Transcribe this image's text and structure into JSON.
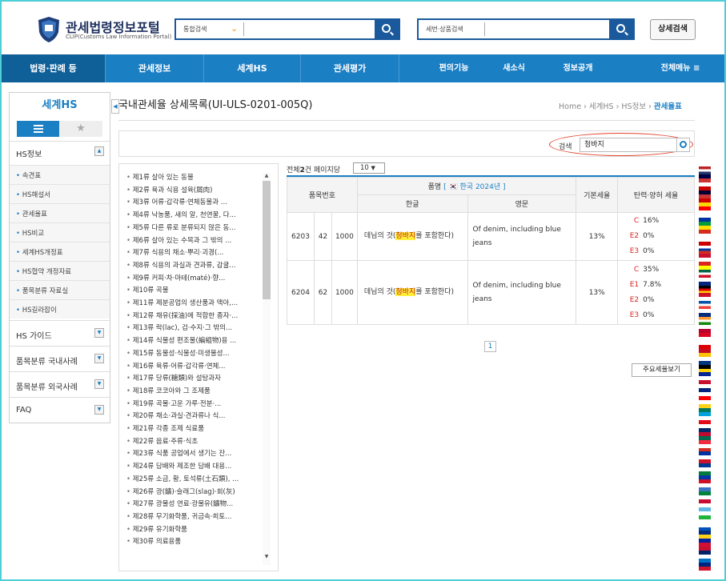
{
  "header": {
    "logo_title": "관세법령정보포털",
    "logo_sub": "CLIP(Customs Law Information Portal)",
    "search1_label": "통합검색",
    "search2_label": "세번·상품검색",
    "detail_search": "상세검색"
  },
  "nav": {
    "items": [
      "법령·판례 등",
      "관세정보",
      "세계HS",
      "관세평가",
      "편의기능",
      "새소식",
      "정보공개",
      "전체메뉴 ≡"
    ]
  },
  "sidebar": {
    "title": "세계HS",
    "section_hs": "HS정보",
    "sub_items": [
      "속견표",
      "HS해설서",
      "관세율표",
      "HS비교",
      "세계HS개정표",
      "HS협약 개정자료",
      "품목분류 자료실",
      "HS길라잡이"
    ],
    "sections": [
      "HS 가이드",
      "품목분류 국내사례",
      "품목분류 외국사례",
      "FAQ"
    ]
  },
  "main": {
    "title": "국내관세율 상세목록(UI-ULS-0201-005Q)",
    "breadcrumb": [
      "Home",
      "세계HS",
      "HS정보",
      "관세율표"
    ],
    "search_label": "검색",
    "search_value": "청바지"
  },
  "chapters": [
    "제1류 살아 있는 동물",
    "제2류 육과 식용 설육(屑肉)",
    "제3류 어류·갑각류·연체동물과 ...",
    "제4류 낙농품, 새의 알, 천연꿀, 다...",
    "제5류 다른 류로 분류되지 않은 동...",
    "제6류 살아 있는 수목과 그 밖의 ...",
    "제7류 식용의 채소·뿌리·괴경(...",
    "제8류 식용의 과실과 견과류, 감귤...",
    "제9류 커피·차·마테(maté)·향...",
    "제10류 곡물",
    "제11류 제분공업의 생산품과 맥아,...",
    "제12류 채유(採油)에 적합한 종자·...",
    "제13류 락(lac), 검·수지·그 밖의...",
    "제14류 식물성 편조물(編組物)용 ...",
    "제15류 동물성·식물성·미생물성...",
    "제16류 육류·어류·갑각류·연체...",
    "제17류 당류(糖類)와 설탕과자",
    "제18류 코코아와 그 조제품",
    "제19류 곡물·고운 가루·전분·...",
    "제20류 채소·과실·견과류나 식...",
    "제21류 각종 조제 식료품",
    "제22류 음료·주류·식초",
    "제23류 식품 공업에서 생기는 잔...",
    "제24류 담배와 제조한 담배 대용...",
    "제25류 소금, 황, 토석류(土石類), ...",
    "제26류 광(鑛)·슬래그(slag)·회(灰)",
    "제27류 광물성 연료·광물유(鑛物...",
    "제28류 무기화학품, 귀금속·희토...",
    "제29류 유기화학품",
    "제30류 의료용품"
  ],
  "results": {
    "count_prefix": "전체",
    "count": "2",
    "count_suffix": "건 페이지당",
    "per_page": "10",
    "headers": {
      "code": "품목번호",
      "name": "품명",
      "name_country": "[ 🇰🇷 한국 2024년 ]",
      "korean": "한글",
      "english": "영문",
      "basic": "기본세율",
      "flex": "탄력·양허 세율"
    },
    "rows": [
      {
        "c1": "6203",
        "c2": "42",
        "c3": "1000",
        "ko_pre": "데님의 것(",
        "ko_hl": "청바지",
        "ko_post": "를 포함한다)",
        "en": "Of denim, including blue jeans",
        "basic": "13%",
        "rates": [
          {
            "code": "C",
            "val": "16%"
          },
          {
            "code": "E2",
            "val": "0%"
          },
          {
            "code": "E3",
            "val": "0%"
          }
        ]
      },
      {
        "c1": "6204",
        "c2": "62",
        "c3": "1000",
        "ko_pre": "데님의 것(",
        "ko_hl": "청바지",
        "ko_post": "를 포함한다)",
        "en": "Of denim, including blue jeans",
        "basic": "13%",
        "rates": [
          {
            "code": "C",
            "val": "35%"
          },
          {
            "code": "E1",
            "val": "7.8%"
          },
          {
            "code": "E2",
            "val": "0%"
          },
          {
            "code": "E3",
            "val": "0%"
          }
        ]
      }
    ],
    "page": "1",
    "rate_view": "주요세율보기"
  },
  "colors": {
    "accent": "#1b7fc4",
    "nav_active": "#0f5f98",
    "highlight": "#ffef3a",
    "rate_code": "#dd2222"
  }
}
